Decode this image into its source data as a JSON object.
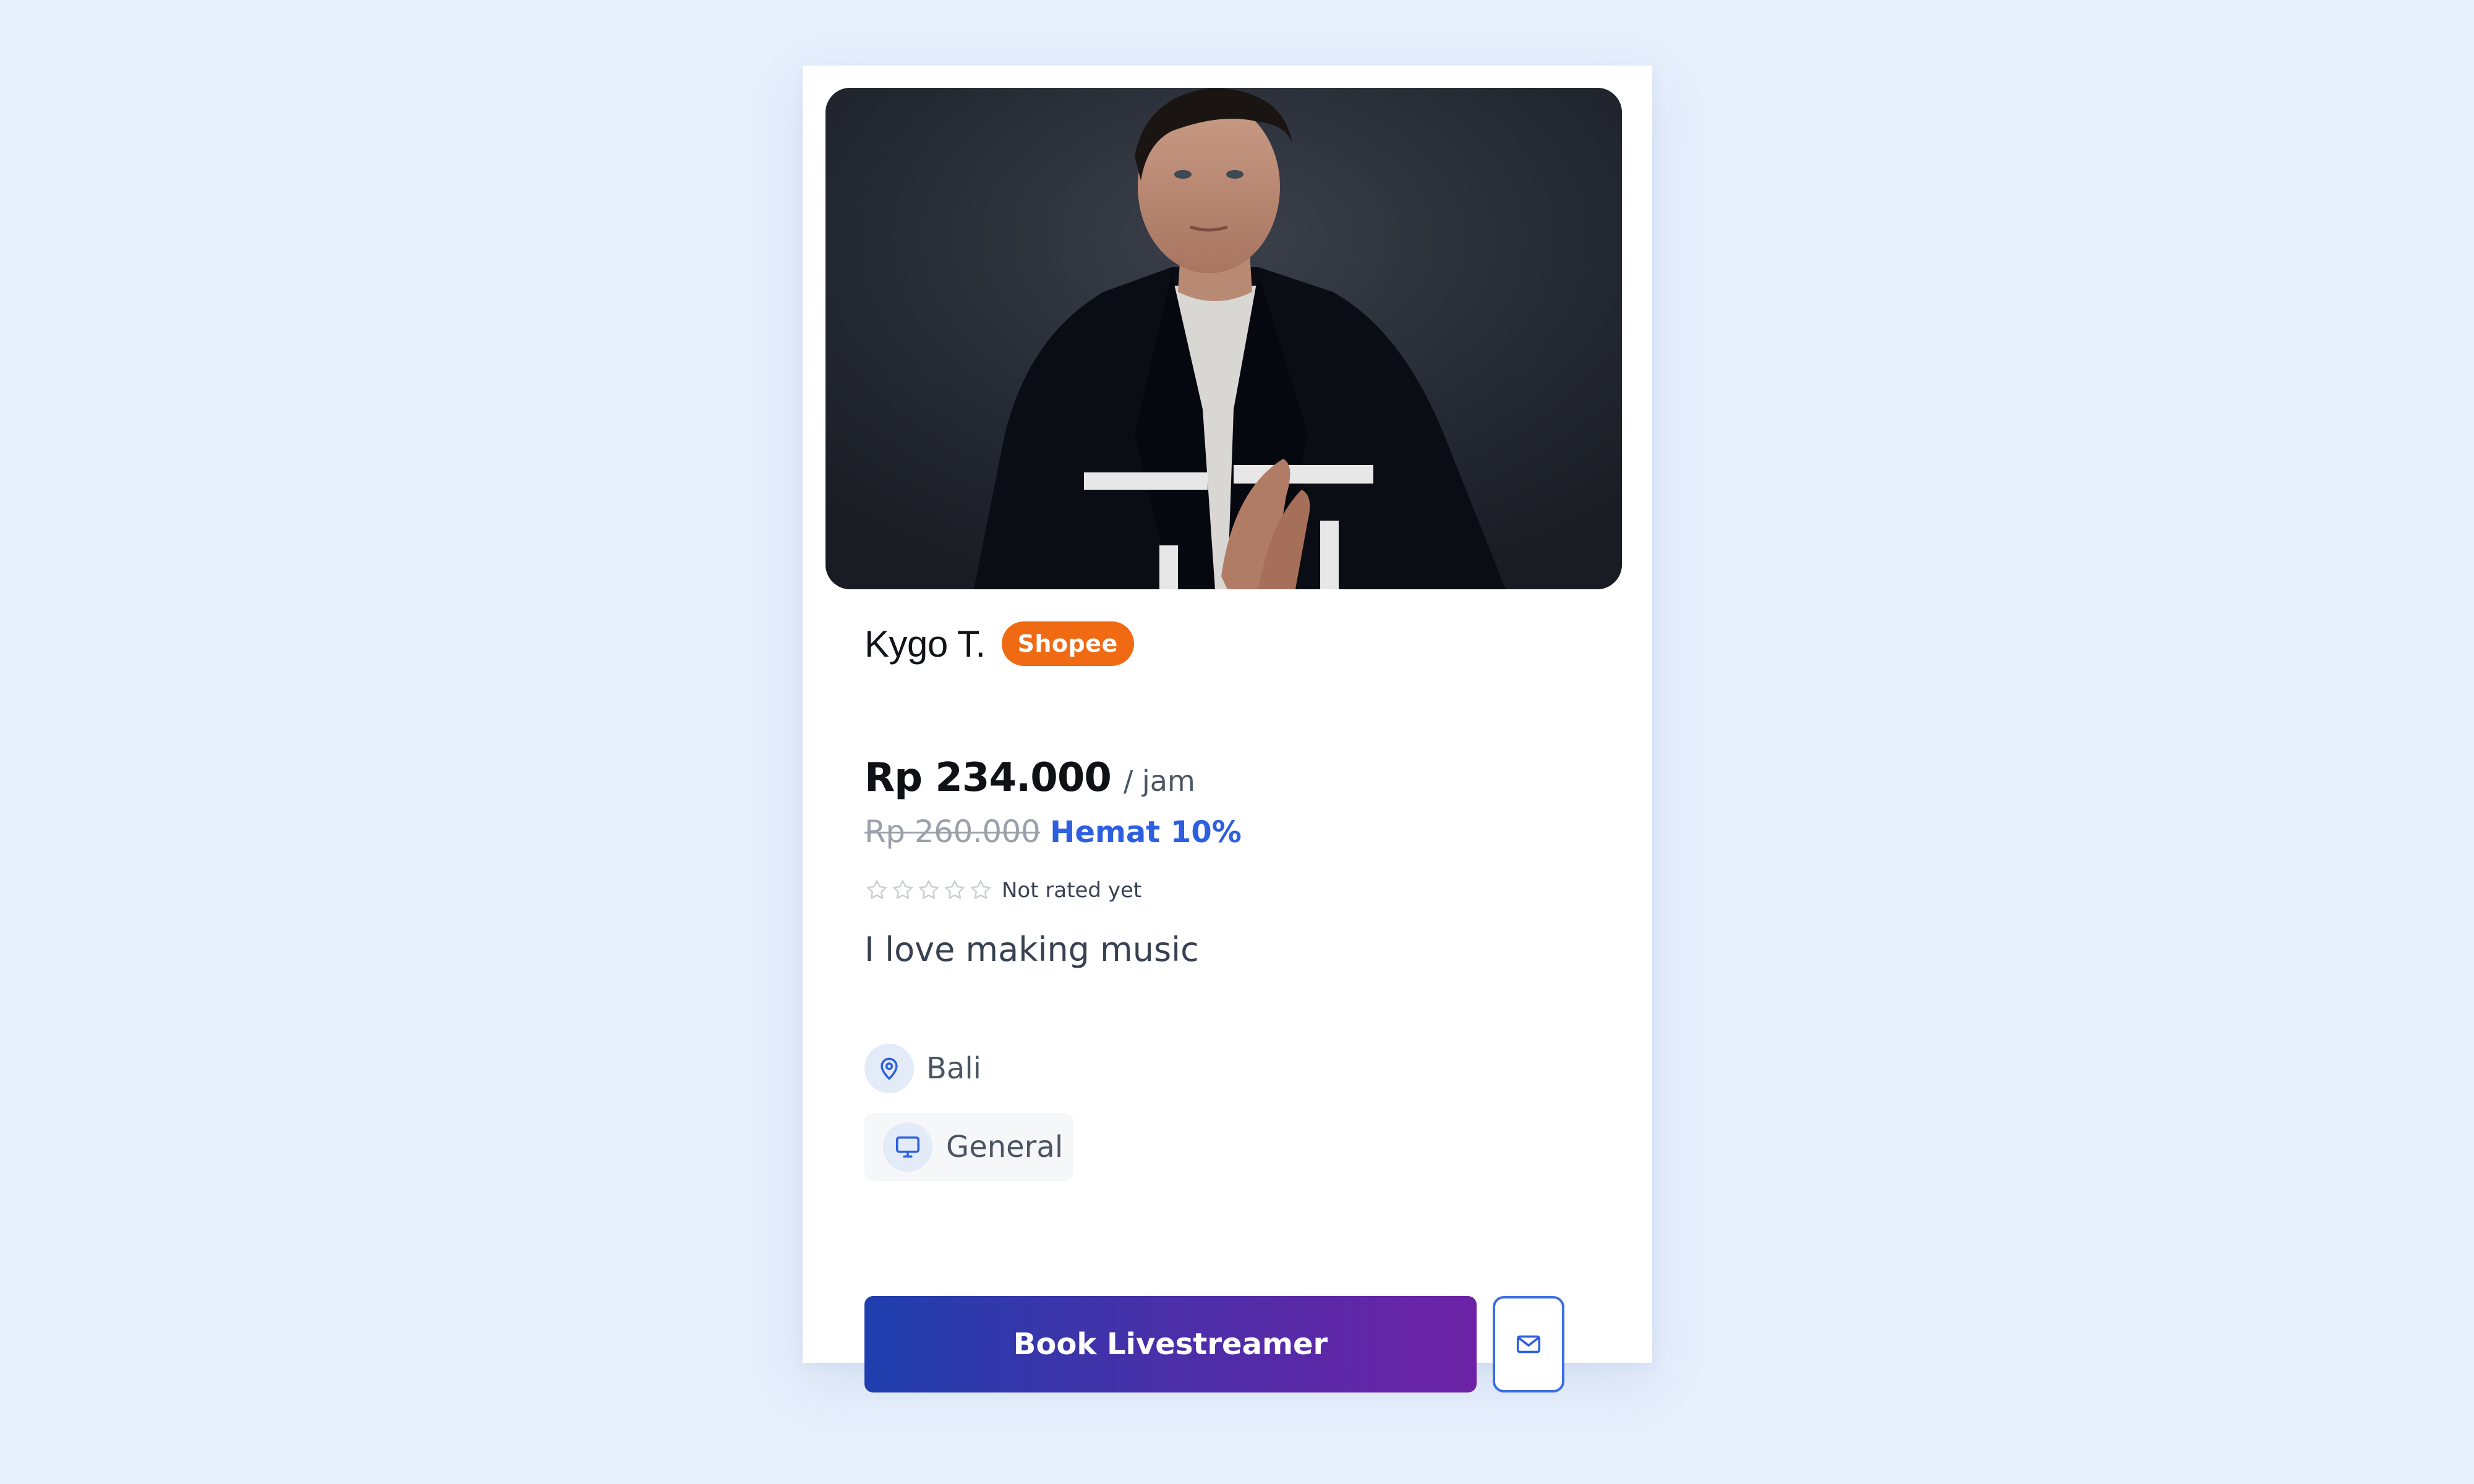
{
  "profile": {
    "name": "Kygo T.",
    "platform_badge": "Shopee",
    "price": "Rp 234.000",
    "price_unit": "/ jam",
    "original_price": "Rp 260.000",
    "discount": "Hemat 10%",
    "rating": {
      "stars_filled": 0,
      "stars_total": 5,
      "text": "Not rated yet"
    },
    "bio": "I love making music",
    "location": "Bali",
    "category": "General"
  },
  "actions": {
    "book_label": "Book Livestreamer",
    "message_icon": "mail-icon"
  },
  "colors": {
    "page_background": "#e6effc",
    "badge": "#f06a14",
    "accent_blue": "#2d5fe0",
    "button_gradient_start": "#1f3fae",
    "button_gradient_end": "#6d22a6"
  },
  "icons": {
    "location": "map-pin-icon",
    "category": "monitor-icon",
    "rating": "star-outline-icon"
  }
}
